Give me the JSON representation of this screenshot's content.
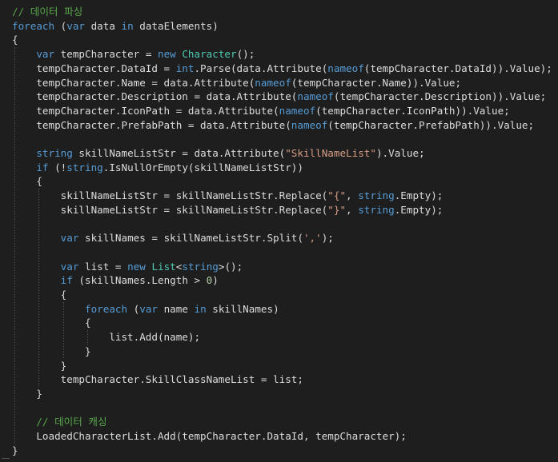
{
  "editor": {
    "lines": [
      [
        {
          "t": "// 데이터 파싱",
          "c": "c"
        }
      ],
      [
        {
          "t": "foreach",
          "c": "k"
        },
        {
          "t": " (",
          "c": "v"
        },
        {
          "t": "var",
          "c": "k"
        },
        {
          "t": " data ",
          "c": "v"
        },
        {
          "t": "in",
          "c": "k"
        },
        {
          "t": " dataElements)",
          "c": "v"
        }
      ],
      [
        {
          "t": "{",
          "c": "v"
        }
      ],
      [
        {
          "t": "    ",
          "c": "v"
        },
        {
          "t": "var",
          "c": "k"
        },
        {
          "t": " tempCharacter = ",
          "c": "v"
        },
        {
          "t": "new",
          "c": "k"
        },
        {
          "t": " ",
          "c": "v"
        },
        {
          "t": "Character",
          "c": "t"
        },
        {
          "t": "();",
          "c": "v"
        }
      ],
      [
        {
          "t": "    tempCharacter.DataId = ",
          "c": "v"
        },
        {
          "t": "int",
          "c": "k"
        },
        {
          "t": ".Parse(data.Attribute(",
          "c": "v"
        },
        {
          "t": "nameof",
          "c": "k"
        },
        {
          "t": "(tempCharacter.DataId)).Value);",
          "c": "v"
        }
      ],
      [
        {
          "t": "    tempCharacter.Name = data.Attribute(",
          "c": "v"
        },
        {
          "t": "nameof",
          "c": "k"
        },
        {
          "t": "(tempCharacter.Name)).Value;",
          "c": "v"
        }
      ],
      [
        {
          "t": "    tempCharacter.Description = data.Attribute(",
          "c": "v"
        },
        {
          "t": "nameof",
          "c": "k"
        },
        {
          "t": "(tempCharacter.Description)).Value;",
          "c": "v"
        }
      ],
      [
        {
          "t": "    tempCharacter.IconPath = data.Attribute(",
          "c": "v"
        },
        {
          "t": "nameof",
          "c": "k"
        },
        {
          "t": "(tempCharacter.IconPath)).Value;",
          "c": "v"
        }
      ],
      [
        {
          "t": "    tempCharacter.PrefabPath = data.Attribute(",
          "c": "v"
        },
        {
          "t": "nameof",
          "c": "k"
        },
        {
          "t": "(tempCharacter.PrefabPath)).Value;",
          "c": "v"
        }
      ],
      [],
      [
        {
          "t": "    ",
          "c": "v"
        },
        {
          "t": "string",
          "c": "k"
        },
        {
          "t": " skillNameListStr = data.Attribute(",
          "c": "v"
        },
        {
          "t": "\"SkillNameList\"",
          "c": "s"
        },
        {
          "t": ").Value;",
          "c": "v"
        }
      ],
      [
        {
          "t": "    ",
          "c": "v"
        },
        {
          "t": "if",
          "c": "k"
        },
        {
          "t": " (!",
          "c": "v"
        },
        {
          "t": "string",
          "c": "k"
        },
        {
          "t": ".IsNullOrEmpty(skillNameListStr))",
          "c": "v"
        }
      ],
      [
        {
          "t": "    {",
          "c": "v"
        }
      ],
      [
        {
          "t": "        skillNameListStr = skillNameListStr.Replace(",
          "c": "v"
        },
        {
          "t": "\"{\"",
          "c": "s"
        },
        {
          "t": ", ",
          "c": "v"
        },
        {
          "t": "string",
          "c": "k"
        },
        {
          "t": ".Empty);",
          "c": "v"
        }
      ],
      [
        {
          "t": "        skillNameListStr = skillNameListStr.Replace(",
          "c": "v"
        },
        {
          "t": "\"}\"",
          "c": "s"
        },
        {
          "t": ", ",
          "c": "v"
        },
        {
          "t": "string",
          "c": "k"
        },
        {
          "t": ".Empty);",
          "c": "v"
        }
      ],
      [],
      [
        {
          "t": "        ",
          "c": "v"
        },
        {
          "t": "var",
          "c": "k"
        },
        {
          "t": " skillNames = skillNameListStr.Split(",
          "c": "v"
        },
        {
          "t": "','",
          "c": "s"
        },
        {
          "t": ");",
          "c": "v"
        }
      ],
      [],
      [
        {
          "t": "        ",
          "c": "v"
        },
        {
          "t": "var",
          "c": "k"
        },
        {
          "t": " list = ",
          "c": "v"
        },
        {
          "t": "new",
          "c": "k"
        },
        {
          "t": " ",
          "c": "v"
        },
        {
          "t": "List",
          "c": "t"
        },
        {
          "t": "<",
          "c": "v"
        },
        {
          "t": "string",
          "c": "k"
        },
        {
          "t": ">();",
          "c": "v"
        }
      ],
      [
        {
          "t": "        ",
          "c": "v"
        },
        {
          "t": "if",
          "c": "k"
        },
        {
          "t": " (skillNames.Length > ",
          "c": "v"
        },
        {
          "t": "0",
          "c": "n"
        },
        {
          "t": ")",
          "c": "v"
        }
      ],
      [
        {
          "t": "        {",
          "c": "v"
        }
      ],
      [
        {
          "t": "            ",
          "c": "v"
        },
        {
          "t": "foreach",
          "c": "k"
        },
        {
          "t": " (",
          "c": "v"
        },
        {
          "t": "var",
          "c": "k"
        },
        {
          "t": " name ",
          "c": "v"
        },
        {
          "t": "in",
          "c": "k"
        },
        {
          "t": " skillNames)",
          "c": "v"
        }
      ],
      [
        {
          "t": "            {",
          "c": "v"
        }
      ],
      [
        {
          "t": "                list.Add(name);",
          "c": "v"
        }
      ],
      [
        {
          "t": "            }",
          "c": "v"
        }
      ],
      [
        {
          "t": "        }",
          "c": "v"
        }
      ],
      [
        {
          "t": "        tempCharacter.SkillClassNameList = list;",
          "c": "v"
        }
      ],
      [
        {
          "t": "    }",
          "c": "v"
        }
      ],
      [],
      [
        {
          "t": "    ",
          "c": "v"
        },
        {
          "t": "// 데이터 캐싱",
          "c": "c"
        }
      ],
      [
        {
          "t": "    LoadedCharacterList.Add(tempCharacter.DataId, tempCharacter);",
          "c": "v"
        }
      ],
      [
        {
          "t": "}",
          "c": "v"
        }
      ]
    ]
  },
  "colors": {
    "background": "#1e1e1e",
    "keyword": "#569cd6",
    "comment": "#57a64a",
    "type": "#4ec9b0",
    "string": "#d69d85",
    "number": "#b5cea8",
    "text": "#dcdcdc"
  }
}
